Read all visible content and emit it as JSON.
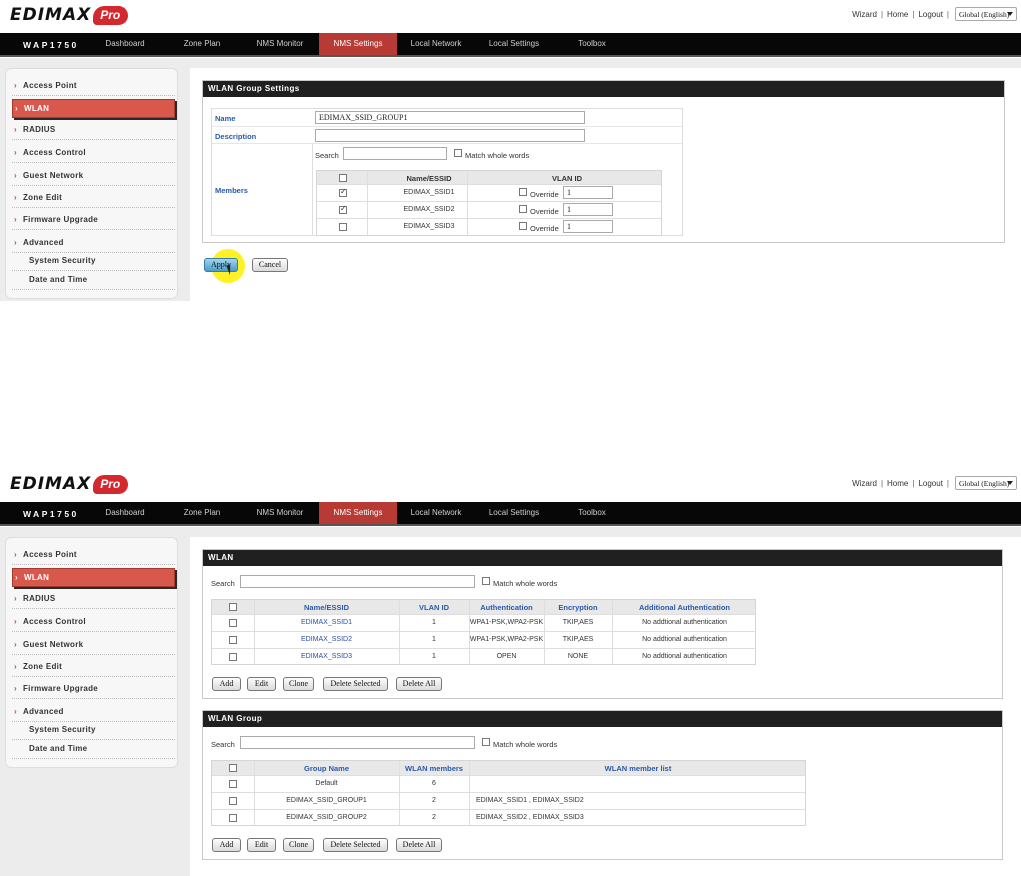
{
  "top1": {
    "logo": "EDIMAX",
    "logo_badge": "Pro",
    "links": [
      "Wizard",
      "Home",
      "Logout"
    ],
    "language": "Global (English)"
  },
  "top2": {
    "logo": "EDIMAX",
    "logo_badge": "Pro",
    "links": [
      "Wizard",
      "Home",
      "Logout"
    ],
    "language": "Global (English)"
  },
  "nav": {
    "model": "WAP1750",
    "items": [
      "Dashboard",
      "Zone Plan",
      "NMS Monitor",
      "NMS Settings",
      "Local Network",
      "Local Settings",
      "Toolbox"
    ],
    "active": "NMS Settings"
  },
  "sidebar": {
    "items": [
      "Access Point",
      "WLAN",
      "RADIUS",
      "Access Control",
      "Guest Network",
      "Zone Edit",
      "Firmware Upgrade",
      "Advanced"
    ],
    "subitems": [
      "System Security",
      "Date and Time"
    ],
    "active": "WLAN"
  },
  "group_settings": {
    "title": "WLAN Group Settings",
    "name_label": "Name",
    "name_value": "EDIMAX_SSID_GROUP1",
    "description_label": "Description",
    "description_value": "",
    "members_label": "Members",
    "search_label": "Search",
    "match_whole_words": "Match whole words",
    "col_name": "Name/ESSID",
    "col_vlan": "VLAN ID",
    "override_label": "Override",
    "members": [
      {
        "name": "EDIMAX_SSID1",
        "checked": true,
        "vlan": "1"
      },
      {
        "name": "EDIMAX_SSID2",
        "checked": true,
        "vlan": "1"
      },
      {
        "name": "EDIMAX_SSID3",
        "checked": false,
        "vlan": "1"
      }
    ],
    "apply": "Apply",
    "cancel": "Cancel"
  },
  "wlan": {
    "title": "WLAN",
    "search_label": "Search",
    "match_whole_words": "Match whole words",
    "headers": [
      "Name/ESSID",
      "VLAN ID",
      "Authentication",
      "Encryption",
      "Additional Authentication"
    ],
    "rows": [
      [
        "EDIMAX_SSID1",
        "1",
        "WPA1-PSK,WPA2-PSK",
        "TKIP,AES",
        "No addtional authentication"
      ],
      [
        "EDIMAX_SSID2",
        "1",
        "WPA1-PSK,WPA2-PSK",
        "TKIP,AES",
        "No addtional authentication"
      ],
      [
        "EDIMAX_SSID3",
        "1",
        "OPEN",
        "NONE",
        "No addtional authentication"
      ]
    ],
    "buttons": [
      "Add",
      "Edit",
      "Clone",
      "Delete Selected",
      "Delete All"
    ]
  },
  "wlan_group": {
    "title": "WLAN Group",
    "search_label": "Search",
    "match_whole_words": "Match whole words",
    "headers": [
      "Group Name",
      "WLAN members",
      "WLAN member list"
    ],
    "rows": [
      [
        "Default",
        "6",
        ""
      ],
      [
        "EDIMAX_SSID_GROUP1",
        "2",
        "EDIMAX_SSID1 , EDIMAX_SSID2"
      ],
      [
        "EDIMAX_SSID_GROUP2",
        "2",
        "EDIMAX_SSID2 , EDIMAX_SSID3"
      ]
    ],
    "buttons": [
      "Add",
      "Edit",
      "Clone",
      "Delete Selected",
      "Delete All"
    ]
  },
  "colors": {
    "nav_active": "#b73a35",
    "sidebar_active": "#d8594c",
    "label_blue": "#2a5aa8",
    "panel_title_bg": "#202020"
  }
}
